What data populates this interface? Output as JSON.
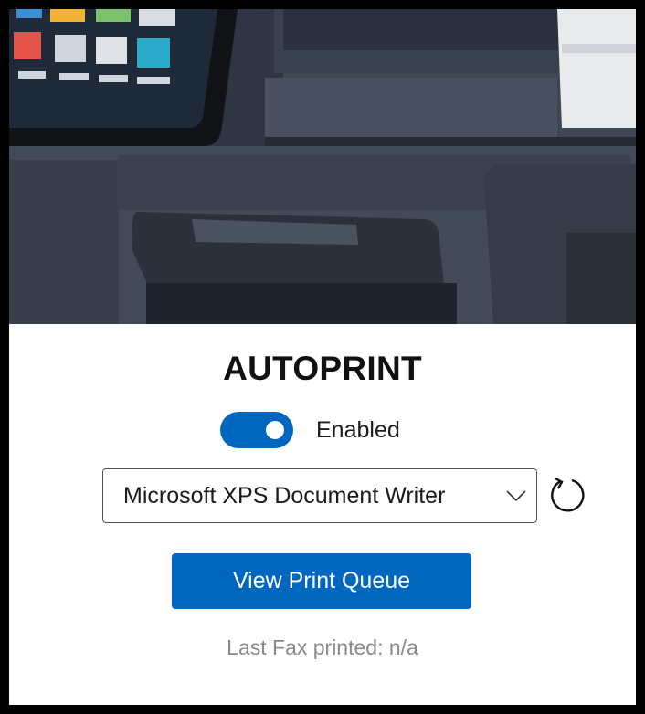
{
  "app": {
    "title": "AUTOPRINT"
  },
  "hero": {
    "image": "printer-photo"
  },
  "toggle": {
    "state": "on",
    "label": "Enabled"
  },
  "printer_select": {
    "selected": "Microsoft XPS Document Writer",
    "chevron_icon": "chevron-down-icon"
  },
  "refresh": {
    "icon": "refresh-icon"
  },
  "actions": {
    "view_queue_label": "View Print Queue"
  },
  "status": {
    "last_fax": "Last Fax printed: n/a"
  },
  "colors": {
    "accent": "#0067c0",
    "status_text": "#8a8a8a"
  }
}
